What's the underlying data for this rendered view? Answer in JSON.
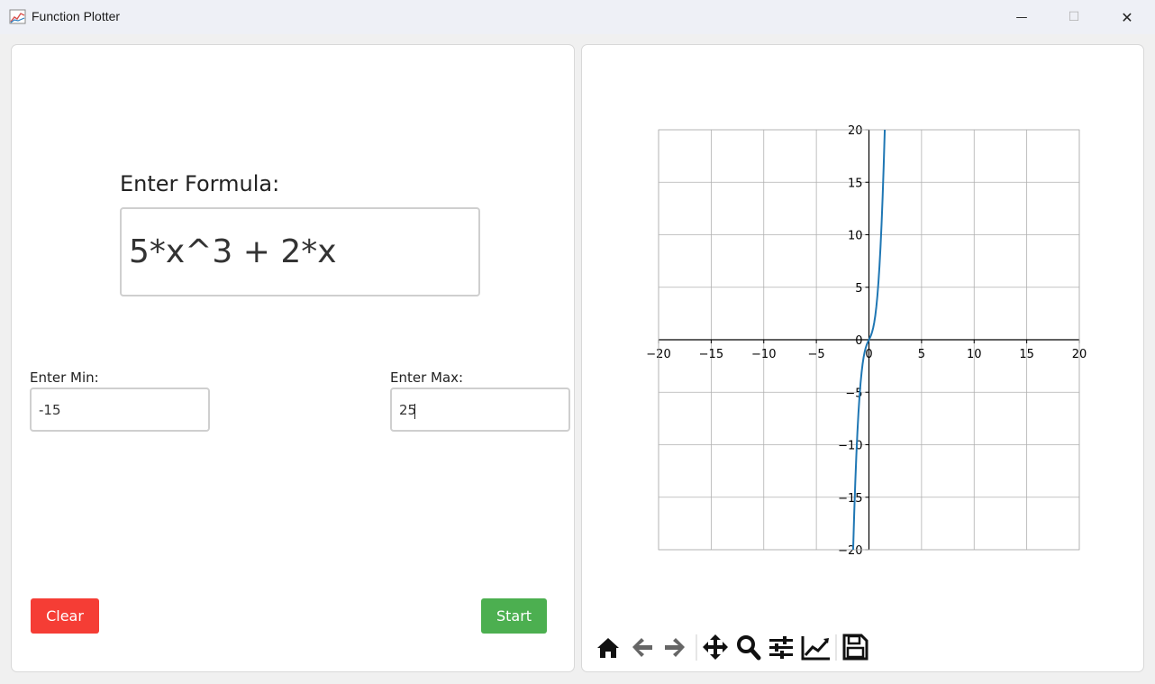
{
  "window": {
    "title": "Function Plotter",
    "minimize_glyph": "—",
    "maximize_glyph": "☐",
    "close_glyph": "✕"
  },
  "form": {
    "formula_label": "Enter Formula:",
    "formula_value": "5*x^3 + 2*x",
    "min_label": "Enter Min:",
    "min_value": "-15",
    "max_label": "Enter Max:",
    "max_value": "25",
    "clear_label": "Clear",
    "start_label": "Start"
  },
  "colors": {
    "clear_button": "#f53d35",
    "start_button": "#4caf50",
    "line": "#1f77b4"
  },
  "toolbar": {
    "icons": [
      "home-icon",
      "back-arrow-icon",
      "forward-arrow-icon",
      "pan-icon",
      "zoom-icon",
      "configure-subplots-icon",
      "edit-axis-icon",
      "save-icon"
    ]
  },
  "chart_data": {
    "type": "line",
    "title": "",
    "xlabel": "",
    "ylabel": "",
    "xlim": [
      -20,
      20
    ],
    "ylim": [
      -20,
      20
    ],
    "xticks": [
      "−20",
      "−15",
      "−10",
      "−5",
      "0",
      "5",
      "10",
      "15",
      "20"
    ],
    "yticks": [
      "20",
      "15",
      "10",
      "5",
      "0",
      "−5",
      "−10",
      "−15",
      "−20"
    ],
    "grid": true,
    "series": [
      {
        "function": "5*x^3 + 2*x",
        "x": [
          -1.55,
          -1.5,
          -1.4,
          -1.3,
          -1.2,
          -1.1,
          -1.0,
          -0.9,
          -0.8,
          -0.7,
          -0.6,
          -0.5,
          -0.4,
          -0.3,
          -0.2,
          -0.1,
          0,
          0.1,
          0.2,
          0.3,
          0.4,
          0.5,
          0.6,
          0.7,
          0.8,
          0.9,
          1.0,
          1.1,
          1.2,
          1.3,
          1.4,
          1.5,
          1.55
        ],
        "y": [
          -21.72,
          -19.88,
          -16.52,
          -13.59,
          -11.04,
          -8.86,
          -7.0,
          -5.45,
          -4.16,
          -3.12,
          -2.28,
          -1.63,
          -1.12,
          -0.74,
          -0.44,
          -0.21,
          0,
          0.21,
          0.44,
          0.74,
          1.12,
          1.63,
          2.28,
          3.12,
          4.16,
          5.45,
          7.0,
          8.86,
          11.04,
          13.59,
          16.52,
          19.88,
          21.72
        ]
      }
    ]
  }
}
